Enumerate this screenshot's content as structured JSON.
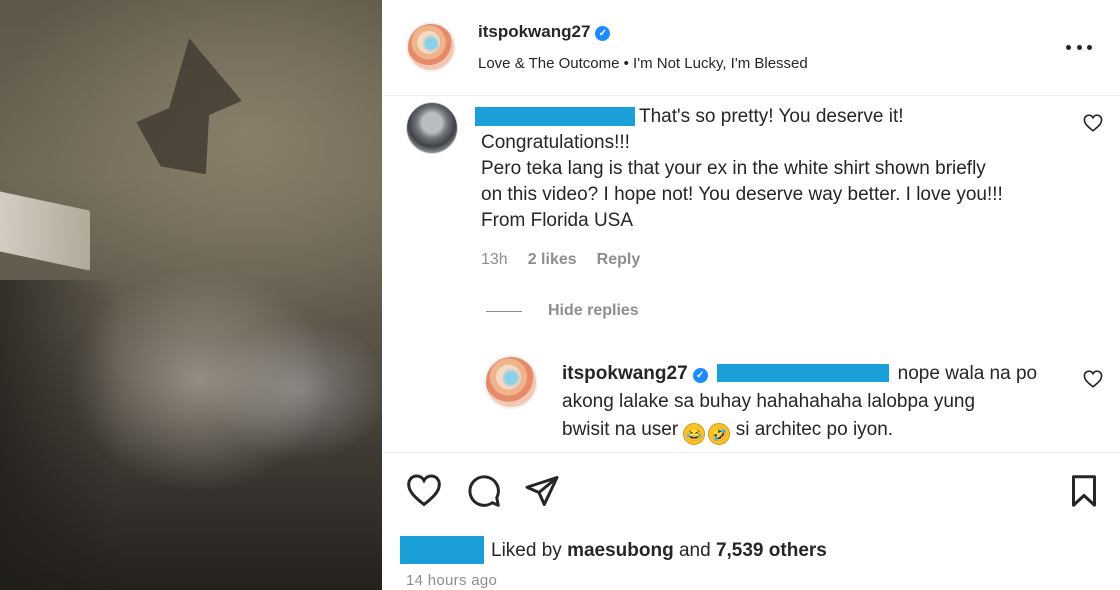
{
  "post": {
    "username": "itspokwang27",
    "verified_mark": "✓",
    "song": "Love & The Outcome • I'm Not Lucky, I'm Blessed",
    "more_icon": "more-horizontal-icon"
  },
  "comment": {
    "first_line": "That's so pretty! You deserve it!",
    "line2": "Congratulations!!!",
    "line3": "Pero teka lang is that your ex in the white shirt shown briefly",
    "line4": "on this video? I hope not! You deserve way better. I love you!!!",
    "line5": "From Florida USA",
    "time": "13h",
    "likes": "2 likes",
    "reply_label": "Reply",
    "hide_replies": "Hide replies"
  },
  "reply": {
    "username": "itspokwang27",
    "verified_mark": "✓",
    "line1": "nope wala na po",
    "line2": "akong lalake sa buhay hahahahaha lalobpa yung",
    "line3_before": "bwisit na user",
    "line3_after": "si architec po iyon.",
    "emoji1": "😂",
    "emoji2": "🤣"
  },
  "actions": {
    "like_icon": "heart-icon",
    "comment_icon": "comment-icon",
    "share_icon": "paper-plane-icon",
    "save_icon": "bookmark-icon"
  },
  "liked_by": {
    "prefix": "Liked by",
    "user": "maesubong",
    "and": "and",
    "others": "7,539 others"
  },
  "timestamp": "14 hours ago",
  "colors": {
    "redaction": "#1a9fd9",
    "verified": "#1a8cff",
    "muted_text": "#8e8e8e",
    "text": "#262626"
  }
}
